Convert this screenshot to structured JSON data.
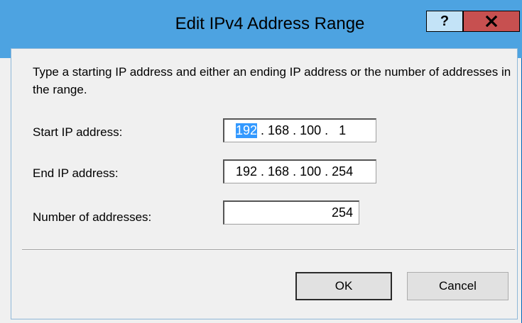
{
  "window": {
    "title": "Edit IPv4 Address Range",
    "help_label": "?",
    "close_label": "x"
  },
  "dialog": {
    "instructions": "Type a starting IP address and either an ending IP address or the number of addresses in the range.",
    "start_label": "Start IP address:",
    "start_ip": {
      "octet1": "192",
      "rest": " . 168 . 100 .   1"
    },
    "end_label": "End IP address:",
    "end_ip": "192 . 168 . 100 . 254",
    "count_label": "Number of addresses:",
    "count_value": "254",
    "ok_label": "OK",
    "cancel_label": "Cancel"
  },
  "colors": {
    "title_bar": "#4da3e1",
    "close_button": "#c75050",
    "selection": "#3399ff"
  }
}
